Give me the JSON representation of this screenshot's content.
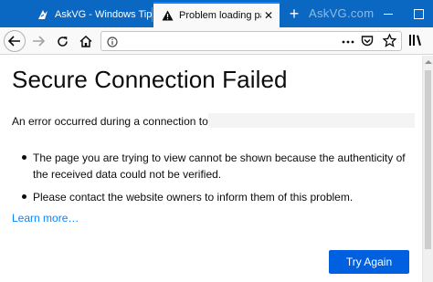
{
  "tabs": [
    {
      "title": "AskVG - Windows Tip",
      "favicon": "askvg-logo-icon"
    },
    {
      "title": "Problem loading page",
      "favicon": "warning-icon",
      "close": "✕"
    }
  ],
  "new_tab": "+",
  "watermark": "AskVG.com",
  "toolbar": {
    "url": "",
    "icons": [
      "back-arrow-icon",
      "forward-arrow-icon",
      "reload-icon",
      "home-icon",
      "info-icon",
      "more-icon",
      "pocket-icon",
      "star-icon",
      "library-icon"
    ]
  },
  "page": {
    "title": "Secure Connection Failed",
    "intro": "An error occurred during a connection to",
    "bullets": [
      "The page you are trying to view cannot be shown because the authenticity of the received data could not be verified.",
      "Please contact the website owners to inform them of this problem."
    ],
    "learn_more": "Learn more…",
    "try_again": "Try Again"
  },
  "colors": {
    "titlebar": "#0a67c2",
    "accent": "#0060df",
    "link": "#0a84ff"
  }
}
